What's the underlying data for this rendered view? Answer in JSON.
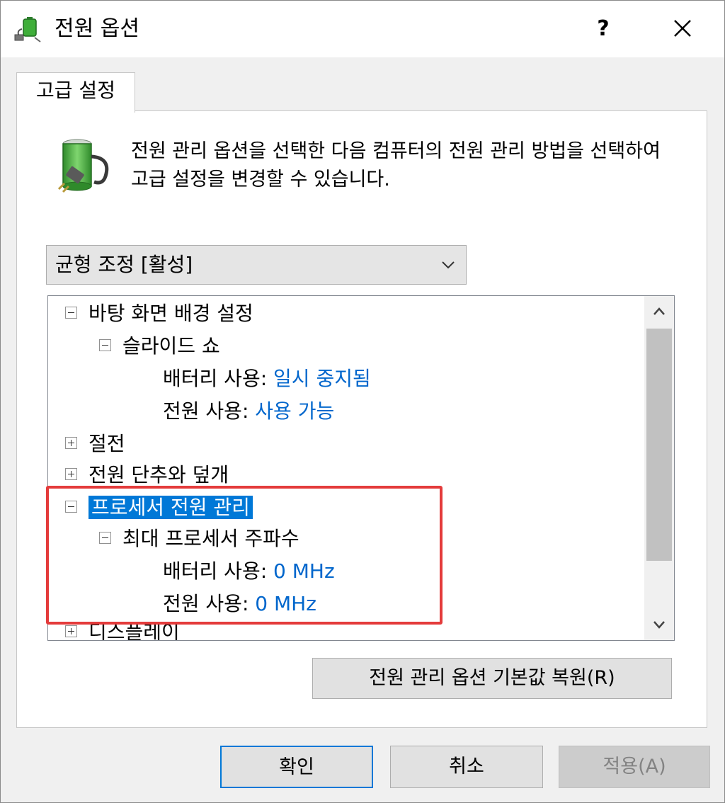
{
  "window": {
    "title": "전원 옵션",
    "help_label": "?"
  },
  "tab": {
    "label": "고급 설정"
  },
  "description": "전원 관리 옵션을 선택한 다음 컴퓨터의 전원 관리 방법을 선택하여 고급 설정을 변경할 수 있습니다.",
  "plan_dropdown": {
    "selected": "균형 조정 [활성]"
  },
  "tree": {
    "items": [
      {
        "label": "바탕 화면 배경 설정",
        "expander": "minus"
      },
      {
        "label": "슬라이드 쇼",
        "expander": "minus"
      },
      {
        "label": "배터리 사용:",
        "value": "일시 중지됨"
      },
      {
        "label": "전원 사용:",
        "value": "사용 가능"
      },
      {
        "label": "절전",
        "expander": "plus"
      },
      {
        "label": "전원 단추와 덮개",
        "expander": "plus"
      },
      {
        "label": "프로세서 전원 관리",
        "expander": "minus"
      },
      {
        "label": "최대 프로세서 주파수",
        "expander": "minus"
      },
      {
        "label": "배터리 사용:",
        "value": "0 MHz"
      },
      {
        "label": "전원 사용:",
        "value": "0 MHz"
      },
      {
        "label": "디스플레이",
        "expander": "plus"
      }
    ]
  },
  "buttons": {
    "restore": "전원 관리 옵션 기본값 복원(R)",
    "ok": "확인",
    "cancel": "취소",
    "apply": "적용(A)"
  },
  "colors": {
    "accent": "#0078d7",
    "link": "#0066cc",
    "highlight_box": "#e43b3b"
  }
}
